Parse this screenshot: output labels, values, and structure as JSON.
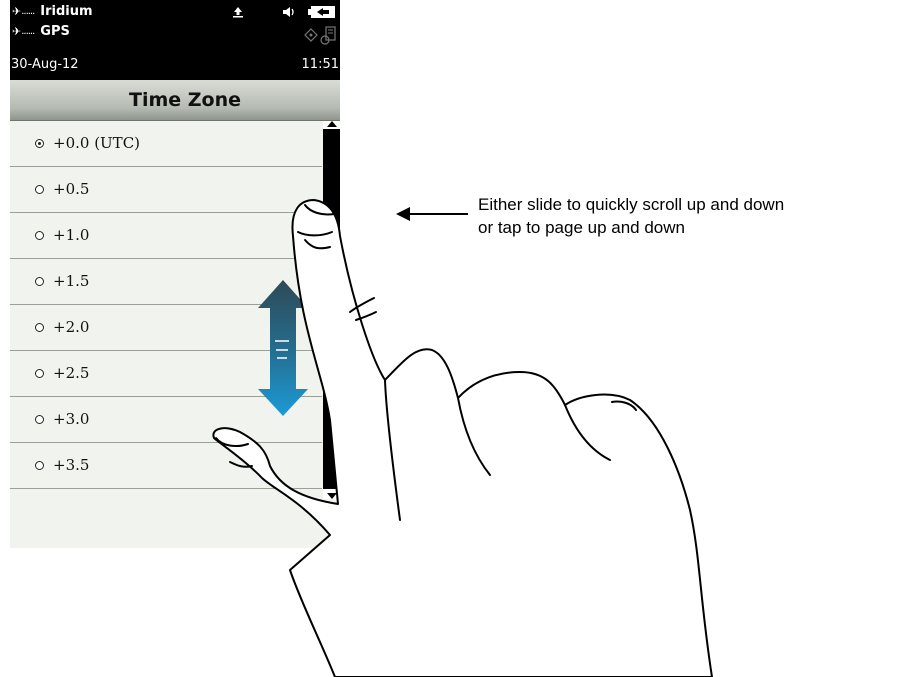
{
  "status_bar": {
    "network_1": "Iridium",
    "network_2": "GPS",
    "date": "30-Aug-12",
    "time": "11:51",
    "signal_dots": "......",
    "icons": {
      "signal": "satellite-signal-icon",
      "upload": "upload-icon",
      "volume": "speaker-icon",
      "battery": "battery-icon",
      "gps_fix": "gps-target-icon",
      "device": "device-icon"
    }
  },
  "screen": {
    "title": "Time Zone",
    "items": [
      {
        "label": "+0.0 (UTC)",
        "selected": true
      },
      {
        "label": "+0.5",
        "selected": false
      },
      {
        "label": "+1.0",
        "selected": false
      },
      {
        "label": "+1.5",
        "selected": false
      },
      {
        "label": "+2.0",
        "selected": false
      },
      {
        "label": "+2.5",
        "selected": false
      },
      {
        "label": "+3.0",
        "selected": false
      },
      {
        "label": "+3.5",
        "selected": false
      }
    ]
  },
  "annotation": {
    "line1": "Either slide to quickly scroll up and down",
    "line2": "or tap to page up and down"
  },
  "colors": {
    "status_bar_bg": "#000000",
    "screen_bg": "#f1f4ee",
    "title_gradient_top": "#d9ddd6",
    "title_gradient_bottom": "#8f958c",
    "arrow_top": "#2e4a57",
    "arrow_bottom": "#1c9ad6"
  }
}
